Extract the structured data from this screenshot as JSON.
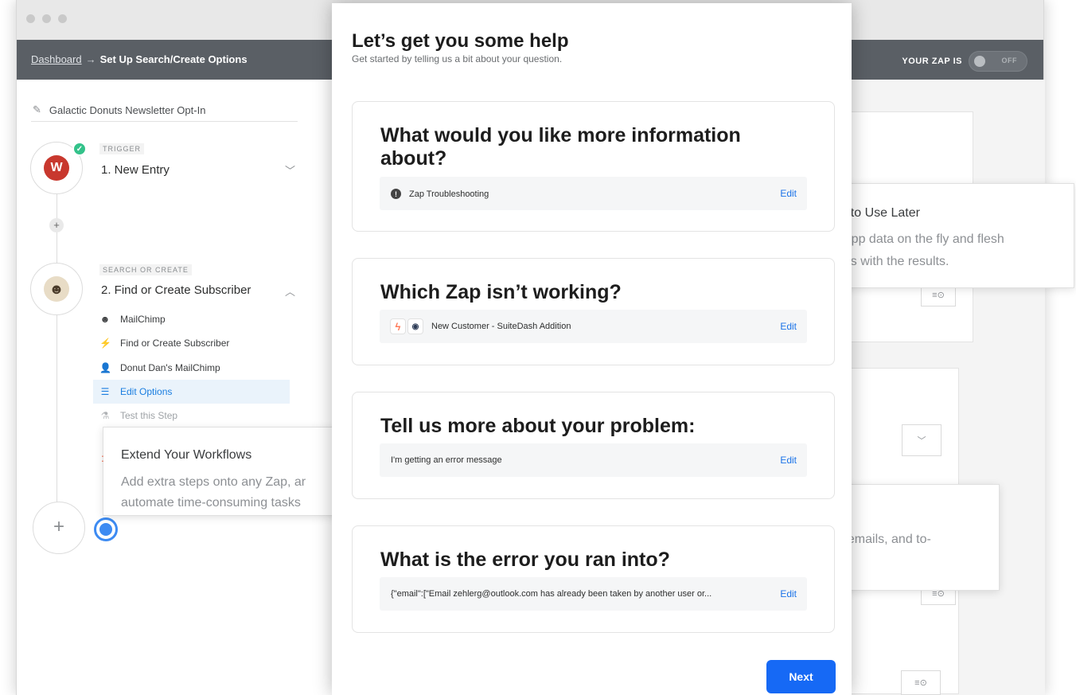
{
  "navbar": {
    "dashboard_link": "Dashboard",
    "breadcrumb_arrow": "→",
    "current_page": "Set Up Search/Create Options",
    "zap_status_label": "YOUR ZAP IS",
    "zap_toggle": "OFF"
  },
  "sidebar": {
    "zap_name": "Galactic Donuts Newsletter Opt-In",
    "steps": [
      {
        "kind": "TRIGGER",
        "title": "1. New Entry",
        "app_letter": "W"
      },
      {
        "kind": "SEARCH OR CREATE",
        "title": "2. Find or Create Subscriber"
      }
    ],
    "sub_items": [
      {
        "label": "MailChimp",
        "icon": "mailchimp-icon"
      },
      {
        "label": "Find or Create Subscriber",
        "icon": "lightning-icon"
      },
      {
        "label": "Donut Dan's MailChimp",
        "icon": "person-icon"
      },
      {
        "label": "Edit Options",
        "icon": "list-icon"
      },
      {
        "label": "Test this Step",
        "icon": "flask-icon"
      }
    ]
  },
  "tooltips": {
    "workflows_title": "Extend Your Workflows",
    "workflows_body_1": "Add extra steps onto any Zap, ar",
    "workflows_body_2": "automate time-consuming tasks",
    "later_title": "fo to Use Later",
    "later_body_1": "r app data on the fly and flesh",
    "later_body_2": "aps with the results.",
    "emails_body": ", emails, and to-"
  },
  "modal": {
    "title": "Let’s get you some help",
    "subtitle": "Get started by telling us a bit about your question.",
    "edit_label": "Edit",
    "next_label": "Next",
    "cards": [
      {
        "question": "What would you like more information about?",
        "answer": "Zap Troubleshooting"
      },
      {
        "question": "Which Zap isn’t working?",
        "answer": "New Customer - SuiteDash Addition"
      },
      {
        "question": "Tell us more about your problem:",
        "answer": "I'm getting an error message"
      },
      {
        "question": "What is the error you ran into?",
        "answer": "{\"email\":[\"Email zehlerg@outlook.com has already been taken by another user or..."
      }
    ]
  },
  "colors": {
    "navbar": "#5a5f65",
    "accent_blue": "#1669f5",
    "link_blue": "#1a73e8",
    "success_green": "#33c28a",
    "wufoo_red": "#c8382e"
  }
}
